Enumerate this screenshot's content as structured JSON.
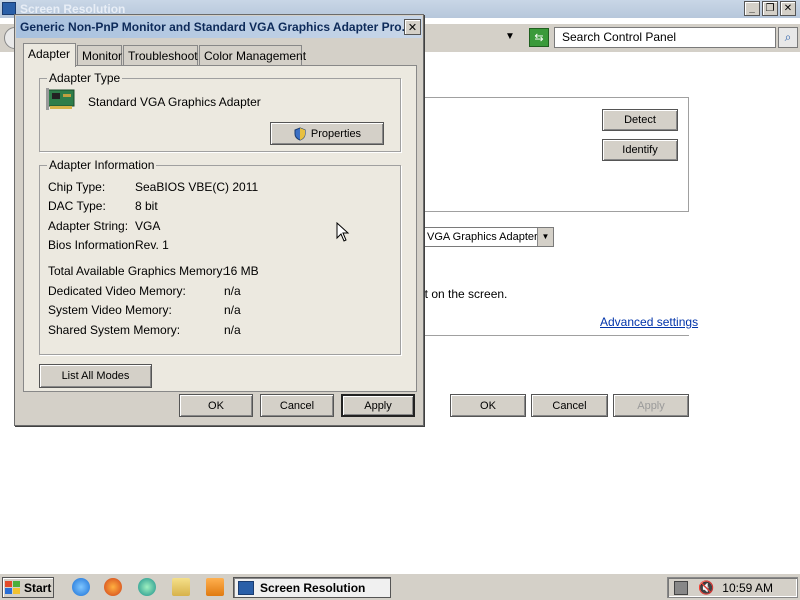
{
  "background_window": {
    "title": "Screen Resolution",
    "search_placeholder": "Search Control Panel",
    "detect_label": "Detect",
    "identify_label": "Identify",
    "display_select_value": "VGA Graphics Adapter",
    "fit_text": "t fit on the screen.",
    "advanced_link": "Advanced settings",
    "ok_label": "OK",
    "cancel_label": "Cancel",
    "apply_label": "Apply"
  },
  "dialog": {
    "title": "Generic Non-PnP Monitor and Standard VGA Graphics Adapter Pro...",
    "close_glyph": "✕",
    "tabs": [
      {
        "label": "Adapter",
        "active": true
      },
      {
        "label": "Monitor",
        "active": false
      },
      {
        "label": "Troubleshoot",
        "active": false
      },
      {
        "label": "Color Management",
        "active": false
      }
    ],
    "adapter_type": {
      "group_label": "Adapter Type",
      "name": "Standard VGA Graphics Adapter",
      "properties_label": "Properties"
    },
    "adapter_info": {
      "group_label": "Adapter Information",
      "rows": [
        {
          "label": "Chip Type:",
          "value": "SeaBIOS VBE(C) 2011"
        },
        {
          "label": "DAC Type:",
          "value": "8 bit"
        },
        {
          "label": "Adapter String:",
          "value": "VGA"
        },
        {
          "label": "Bios Information:",
          "value": "Rev. 1"
        }
      ],
      "memory_rows": [
        {
          "label": "Total Available Graphics Memory:",
          "value": "16 MB"
        },
        {
          "label": "Dedicated Video Memory:",
          "value": "n/a"
        },
        {
          "label": "System Video Memory:",
          "value": "n/a"
        },
        {
          "label": "Shared System Memory:",
          "value": "n/a"
        }
      ]
    },
    "list_all_modes_label": "List All Modes",
    "ok_label": "OK",
    "cancel_label": "Cancel",
    "apply_label": "Apply"
  },
  "taskbar": {
    "start_label": "Start",
    "task_label": "Screen Resolution",
    "clock": "10:59 AM"
  },
  "colors": {
    "dialog_face": "#d4d0c8",
    "tab_face": "#ece9e0",
    "title_text": "#0d2a59",
    "link": "#0033aa"
  }
}
